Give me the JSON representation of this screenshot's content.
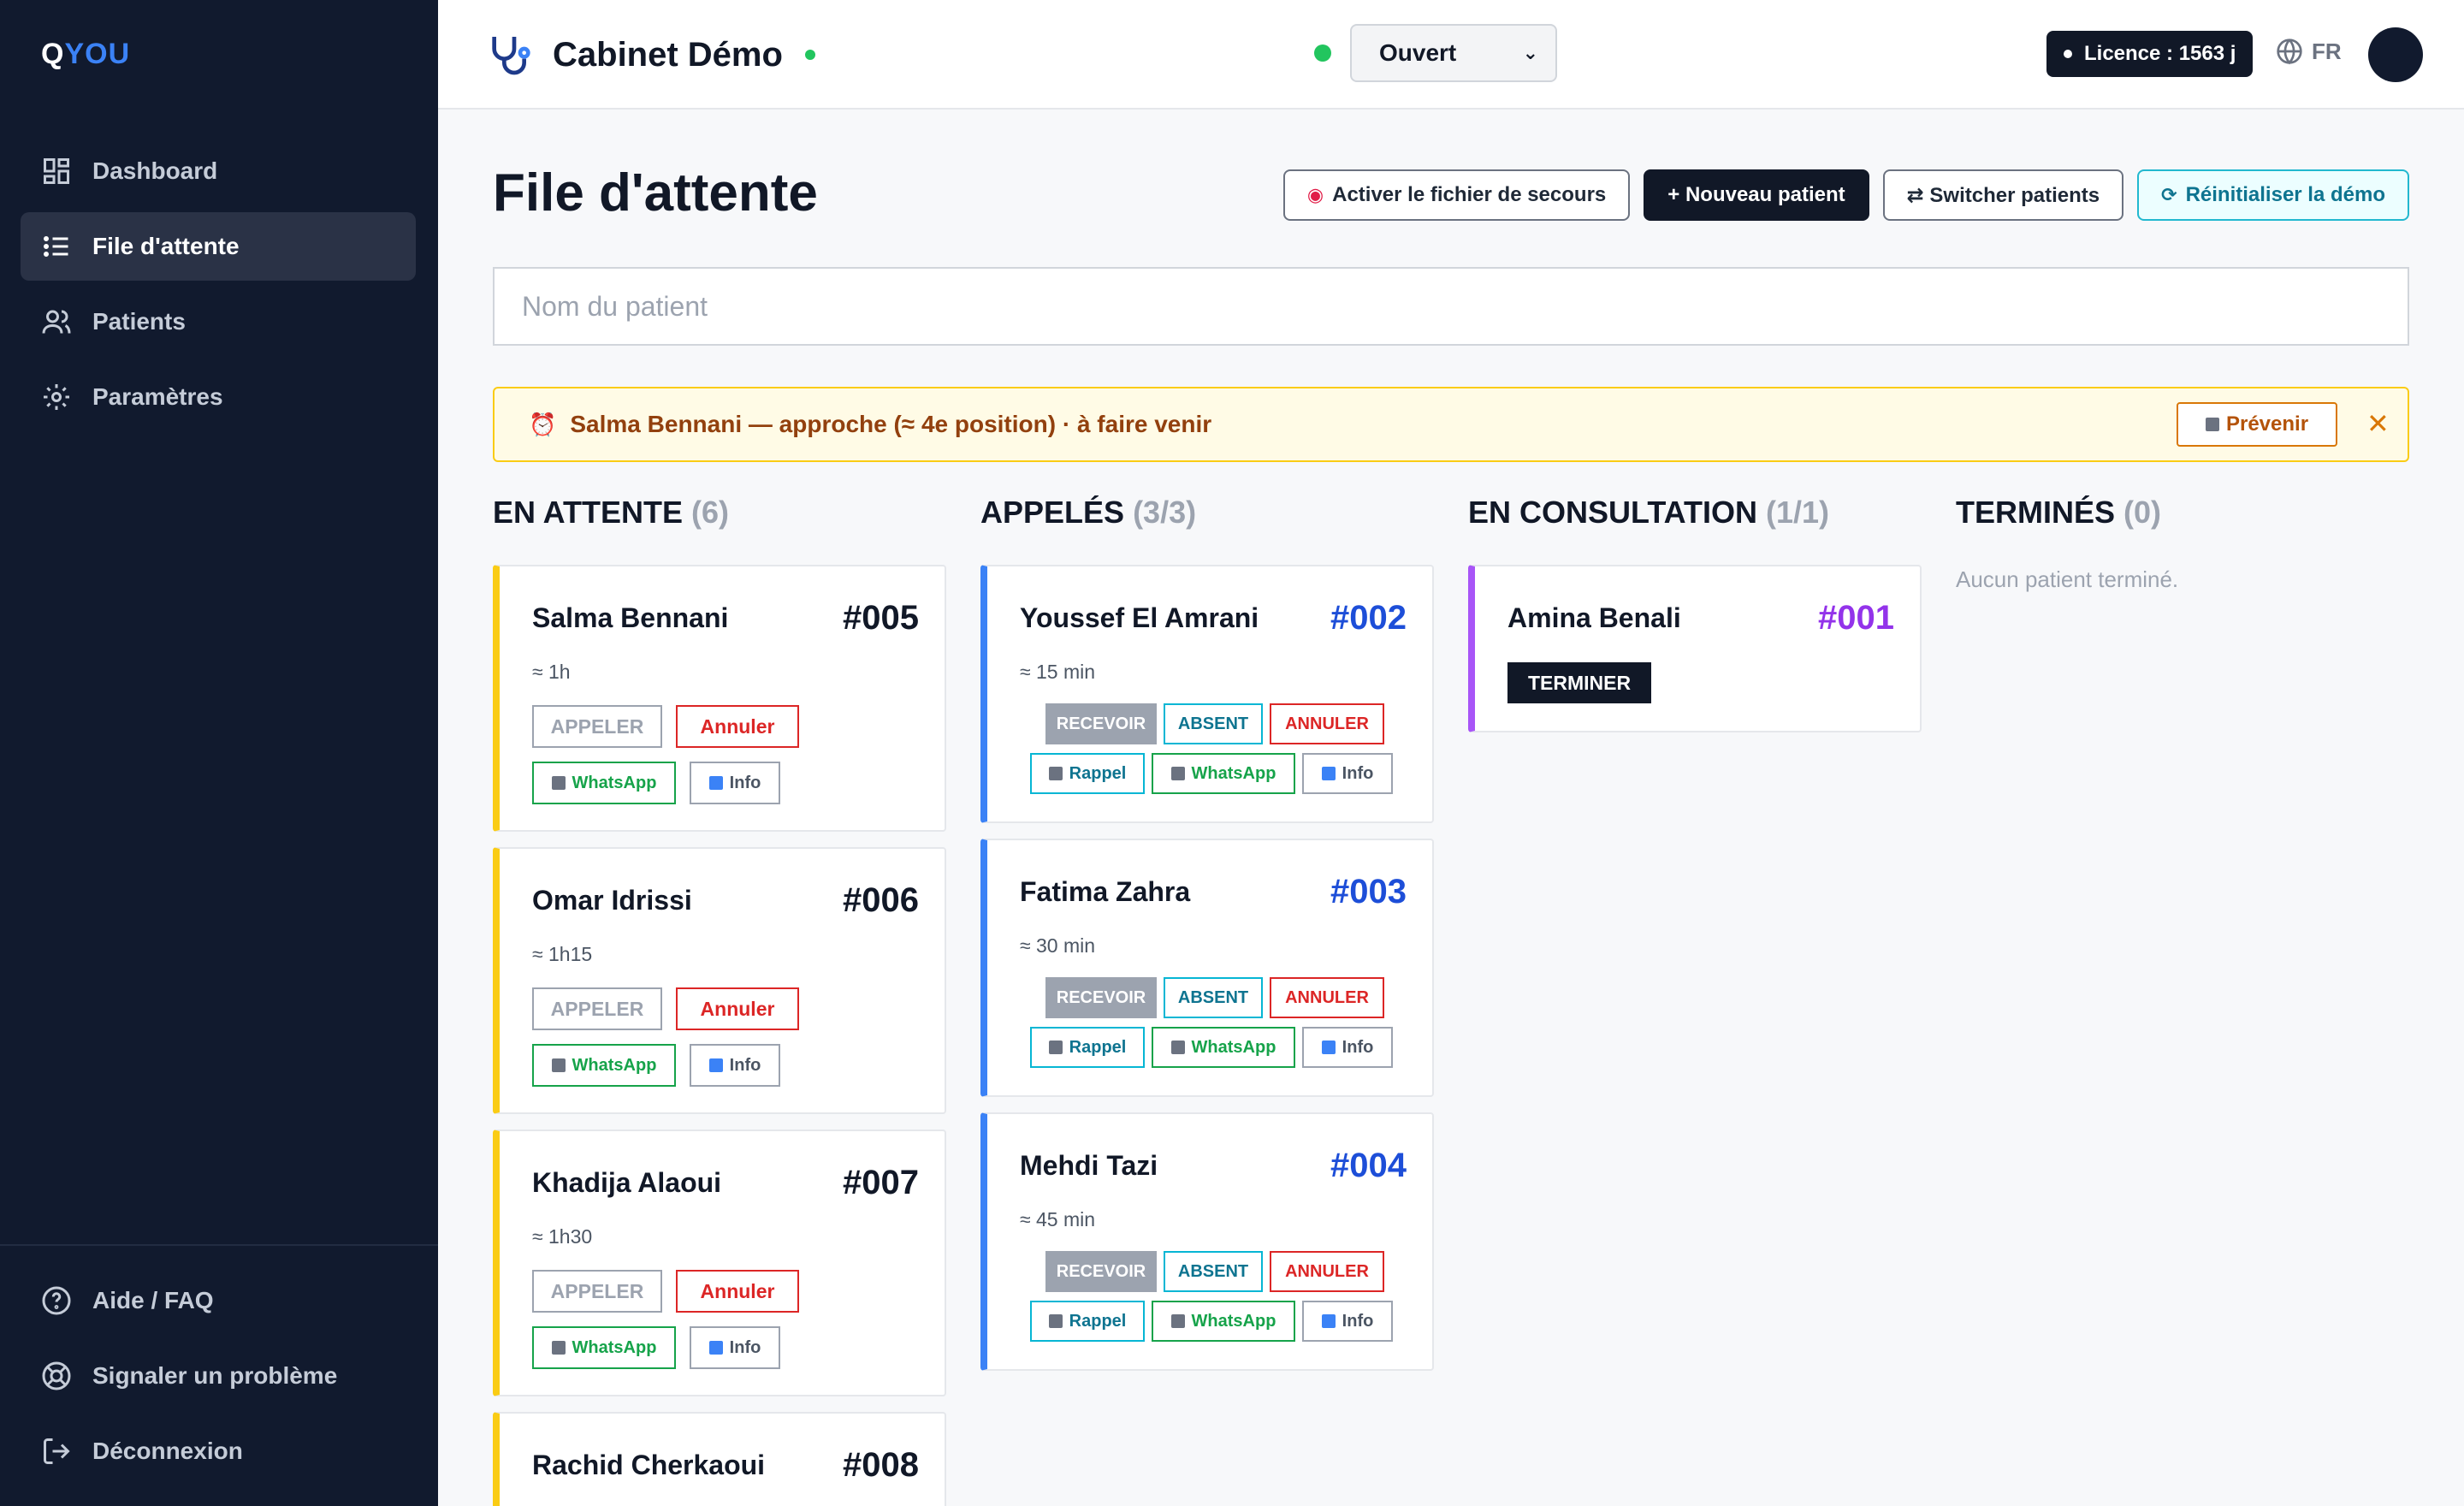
{
  "brand": {
    "logo_q": "Q",
    "logo_rest": "YOU"
  },
  "sidebar": {
    "items": [
      {
        "label": "Dashboard"
      },
      {
        "label": "File d'attente"
      },
      {
        "label": "Patients"
      },
      {
        "label": "Paramètres"
      }
    ],
    "bottom": [
      {
        "label": "Aide / FAQ"
      },
      {
        "label": "Signaler un problème"
      },
      {
        "label": "Déconnexion"
      }
    ]
  },
  "topbar": {
    "cabinet": "Cabinet Démo",
    "status_value": "Ouvert",
    "licence": "Licence : 1563 j",
    "lang": "FR"
  },
  "page": {
    "title": "File d'attente",
    "actions": {
      "backup": "Activer le fichier de secours",
      "new_patient": "+ Nouveau patient",
      "switch": "⇄ Switcher patients",
      "reset": "Réinitialiser la démo"
    },
    "search_placeholder": "Nom du patient"
  },
  "alert": {
    "text": "Salma Bennani — approche (≈ 4e position) · à faire venir",
    "button": "Prévenir",
    "close": "✕"
  },
  "columns": {
    "waiting": {
      "title": "EN ATTENTE",
      "count": "(6)"
    },
    "called": {
      "title": "APPELÉS",
      "count": "(3/3)"
    },
    "consult": {
      "title": "EN CONSULTATION",
      "count": "(1/1)"
    },
    "done": {
      "title": "TERMINÉS",
      "count": "(0)",
      "empty": "Aucun patient terminé."
    }
  },
  "labels": {
    "appeler": "APPELER",
    "annuler": "Annuler",
    "whatsapp": "WhatsApp",
    "info": "Info",
    "recevoir": "RECEVOIR",
    "absent": "ABSENT",
    "annuler_caps": "ANNULER",
    "rappel": "Rappel",
    "terminer": "TERMINER"
  },
  "waiting": [
    {
      "name": "Salma Bennani",
      "num": "#005",
      "wait": "≈ 1h"
    },
    {
      "name": "Omar Idrissi",
      "num": "#006",
      "wait": "≈ 1h15"
    },
    {
      "name": "Khadija Alaoui",
      "num": "#007",
      "wait": "≈ 1h30"
    },
    {
      "name": "Rachid Cherkaoui",
      "num": "#008"
    }
  ],
  "called": [
    {
      "name": "Youssef El Amrani",
      "num": "#002",
      "wait": "≈ 15 min"
    },
    {
      "name": "Fatima Zahra",
      "num": "#003",
      "wait": "≈ 30 min"
    },
    {
      "name": "Mehdi Tazi",
      "num": "#004",
      "wait": "≈ 45 min"
    }
  ],
  "consult": [
    {
      "name": "Amina Benali",
      "num": "#001"
    }
  ],
  "colors": {
    "sidebar": "#111a2e",
    "waiting_accent": "#facc15",
    "called_accent": "#3b82f6",
    "consult_accent": "#a855f7",
    "status_open": "#22c55e"
  }
}
